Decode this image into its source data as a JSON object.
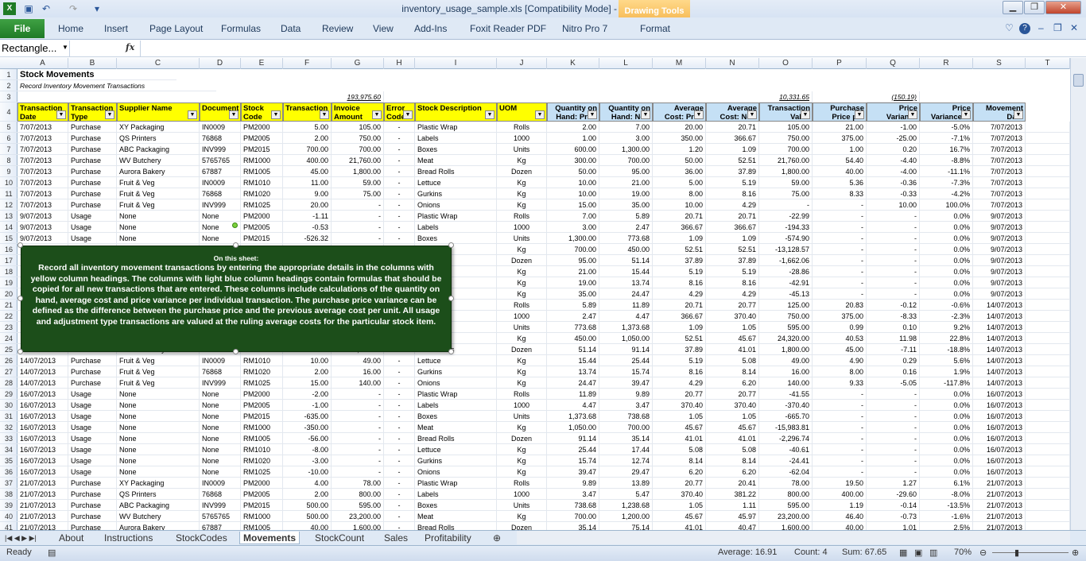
{
  "window": {
    "title": "inventory_usage_sample.xls  [Compatibility Mode]  -  Microsoft Excel",
    "context_tab": "Drawing Tools",
    "context_subtab": "Format"
  },
  "ribbon": {
    "file": "File",
    "tabs": [
      "Home",
      "Insert",
      "Page Layout",
      "Formulas",
      "Data",
      "Review",
      "View",
      "Add-Ins",
      "Foxit Reader PDF",
      "Nitro Pro 7"
    ]
  },
  "formula_bar": {
    "name_box": "Rectangle...",
    "fx": "fx",
    "formula": ""
  },
  "columns": [
    "A",
    "B",
    "C",
    "D",
    "E",
    "F",
    "G",
    "H",
    "I",
    "J",
    "K",
    "L",
    "M",
    "N",
    "O",
    "P",
    "Q",
    "R",
    "S",
    "T"
  ],
  "title": "Stock Movements",
  "subtitle": "Record Inventory Movement Transactions",
  "totals": {
    "G": "193,975.60",
    "O": "10,331.65",
    "Q": "(150.19)"
  },
  "headers": [
    "Transaction Date",
    "Transaction Type",
    "Supplier Name",
    "Document",
    "Stock Code",
    "Transaction",
    "Invoice Amount",
    "Error Code",
    "Stock Description",
    "UOM",
    "Quantity on Hand: Prior",
    "Quantity on Hand: New",
    "Average Cost: Prior",
    "Average Cost: New",
    "Transaction Value",
    "Purchase Price per",
    "Price Variance",
    "Price Variance %",
    "Movement Date"
  ],
  "rows": [
    [
      "7/07/2013",
      "Purchase",
      "XY Packaging",
      "IN0009",
      "PM2000",
      "5.00",
      "105.00",
      "-",
      "Plastic Wrap",
      "Rolls",
      "2.00",
      "7.00",
      "20.00",
      "20.71",
      "105.00",
      "21.00",
      "-1.00",
      "-5.0%",
      "7/07/2013"
    ],
    [
      "7/07/2013",
      "Purchase",
      "QS Printers",
      "76868",
      "PM2005",
      "2.00",
      "750.00",
      "-",
      "Labels",
      "1000",
      "1.00",
      "3.00",
      "350.00",
      "366.67",
      "750.00",
      "375.00",
      "-25.00",
      "-7.1%",
      "7/07/2013"
    ],
    [
      "7/07/2013",
      "Purchase",
      "ABC Packaging",
      "INV999",
      "PM2015",
      "700.00",
      "700.00",
      "-",
      "Boxes",
      "Units",
      "600.00",
      "1,300.00",
      "1.20",
      "1.09",
      "700.00",
      "1.00",
      "0.20",
      "16.7%",
      "7/07/2013"
    ],
    [
      "7/07/2013",
      "Purchase",
      "WV Butchery",
      "5765765",
      "RM1000",
      "400.00",
      "21,760.00",
      "-",
      "Meat",
      "Kg",
      "300.00",
      "700.00",
      "50.00",
      "52.51",
      "21,760.00",
      "54.40",
      "-4.40",
      "-8.8%",
      "7/07/2013"
    ],
    [
      "7/07/2013",
      "Purchase",
      "Aurora Bakery",
      "67887",
      "RM1005",
      "45.00",
      "1,800.00",
      "-",
      "Bread Rolls",
      "Dozen",
      "50.00",
      "95.00",
      "36.00",
      "37.89",
      "1,800.00",
      "40.00",
      "-4.00",
      "-11.1%",
      "7/07/2013"
    ],
    [
      "7/07/2013",
      "Purchase",
      "Fruit & Veg",
      "IN0009",
      "RM1010",
      "11.00",
      "59.00",
      "-",
      "Lettuce",
      "Kg",
      "10.00",
      "21.00",
      "5.00",
      "5.19",
      "59.00",
      "5.36",
      "-0.36",
      "-7.3%",
      "7/07/2013"
    ],
    [
      "7/07/2013",
      "Purchase",
      "Fruit & Veg",
      "76868",
      "RM1020",
      "9.00",
      "75.00",
      "-",
      "Gurkins",
      "Kg",
      "10.00",
      "19.00",
      "8.00",
      "8.16",
      "75.00",
      "8.33",
      "-0.33",
      "-4.2%",
      "7/07/2013"
    ],
    [
      "7/07/2013",
      "Purchase",
      "Fruit & Veg",
      "INV999",
      "RM1025",
      "20.00",
      "-",
      "-",
      "Onions",
      "Kg",
      "15.00",
      "35.00",
      "10.00",
      "4.29",
      "-",
      "-",
      "10.00",
      "100.0%",
      "7/07/2013"
    ],
    [
      "9/07/2013",
      "Usage",
      "None",
      "None",
      "PM2000",
      "-1.11",
      "-",
      "-",
      "Plastic Wrap",
      "Rolls",
      "7.00",
      "5.89",
      "20.71",
      "20.71",
      "-22.99",
      "-",
      "-",
      "0.0%",
      "9/07/2013"
    ],
    [
      "9/07/2013",
      "Usage",
      "None",
      "None",
      "PM2005",
      "-0.53",
      "-",
      "-",
      "Labels",
      "1000",
      "3.00",
      "2.47",
      "366.67",
      "366.67",
      "-194.33",
      "-",
      "-",
      "0.0%",
      "9/07/2013"
    ],
    [
      "9/07/2013",
      "Usage",
      "None",
      "None",
      "PM2015",
      "-526.32",
      "-",
      "-",
      "Boxes",
      "Units",
      "1,300.00",
      "773.68",
      "1.09",
      "1.09",
      "-574.90",
      "-",
      "-",
      "0.0%",
      "9/07/2013"
    ],
    [
      "",
      "",
      "",
      "",
      "",
      "",
      "",
      "",
      "",
      "Kg",
      "700.00",
      "450.00",
      "52.51",
      "52.51",
      "-13,128.57",
      "-",
      "-",
      "0.0%",
      "9/07/2013"
    ],
    [
      "",
      "",
      "",
      "",
      "",
      "",
      "",
      "",
      "ls",
      "Dozen",
      "95.00",
      "51.14",
      "37.89",
      "37.89",
      "-1,662.06",
      "-",
      "-",
      "0.0%",
      "9/07/2013"
    ],
    [
      "",
      "",
      "",
      "",
      "",
      "",
      "",
      "",
      "",
      "Kg",
      "21.00",
      "15.44",
      "5.19",
      "5.19",
      "-28.86",
      "-",
      "-",
      "0.0%",
      "9/07/2013"
    ],
    [
      "",
      "",
      "",
      "",
      "",
      "",
      "",
      "",
      "",
      "Kg",
      "19.00",
      "13.74",
      "8.16",
      "8.16",
      "-42.91",
      "-",
      "-",
      "0.0%",
      "9/07/2013"
    ],
    [
      "",
      "",
      "",
      "",
      "",
      "",
      "",
      "",
      "",
      "Kg",
      "35.00",
      "24.47",
      "4.29",
      "4.29",
      "-45.13",
      "-",
      "-",
      "0.0%",
      "9/07/2013"
    ],
    [
      "",
      "",
      "",
      "",
      "",
      "",
      "",
      "",
      "ap",
      "Rolls",
      "5.89",
      "11.89",
      "20.71",
      "20.77",
      "125.00",
      "20.83",
      "-0.12",
      "-0.6%",
      "14/07/2013"
    ],
    [
      "",
      "",
      "",
      "",
      "",
      "",
      "",
      "",
      "",
      "1000",
      "2.47",
      "4.47",
      "366.67",
      "370.40",
      "750.00",
      "375.00",
      "-8.33",
      "-2.3%",
      "14/07/2013"
    ],
    [
      "",
      "",
      "",
      "",
      "",
      "",
      "",
      "",
      "",
      "Units",
      "773.68",
      "1,373.68",
      "1.09",
      "1.05",
      "595.00",
      "0.99",
      "0.10",
      "9.2%",
      "14/07/2013"
    ],
    [
      "",
      "",
      "",
      "",
      "",
      "",
      "",
      "",
      "",
      "Kg",
      "450.00",
      "1,050.00",
      "52.51",
      "45.67",
      "24,320.00",
      "40.53",
      "11.98",
      "22.8%",
      "14/07/2013"
    ],
    [
      "14/07/2013",
      "Purchase",
      "Aurora Bakery",
      "67887",
      "RM1005",
      "40.00",
      "1,800.00",
      "-",
      "Bread Rolls",
      "Dozen",
      "51.14",
      "91.14",
      "37.89",
      "41.01",
      "1,800.00",
      "45.00",
      "-7.11",
      "-18.8%",
      "14/07/2013"
    ],
    [
      "14/07/2013",
      "Purchase",
      "Fruit & Veg",
      "IN0009",
      "RM1010",
      "10.00",
      "49.00",
      "-",
      "Lettuce",
      "Kg",
      "15.44",
      "25.44",
      "5.19",
      "5.08",
      "49.00",
      "4.90",
      "0.29",
      "5.6%",
      "14/07/2013"
    ],
    [
      "14/07/2013",
      "Purchase",
      "Fruit & Veg",
      "76868",
      "RM1020",
      "2.00",
      "16.00",
      "-",
      "Gurkins",
      "Kg",
      "13.74",
      "15.74",
      "8.16",
      "8.14",
      "16.00",
      "8.00",
      "0.16",
      "1.9%",
      "14/07/2013"
    ],
    [
      "14/07/2013",
      "Purchase",
      "Fruit & Veg",
      "INV999",
      "RM1025",
      "15.00",
      "140.00",
      "-",
      "Onions",
      "Kg",
      "24.47",
      "39.47",
      "4.29",
      "6.20",
      "140.00",
      "9.33",
      "-5.05",
      "-117.8%",
      "14/07/2013"
    ],
    [
      "16/07/2013",
      "Usage",
      "None",
      "None",
      "PM2000",
      "-2.00",
      "-",
      "-",
      "Plastic Wrap",
      "Rolls",
      "11.89",
      "9.89",
      "20.77",
      "20.77",
      "-41.55",
      "-",
      "-",
      "0.0%",
      "16/07/2013"
    ],
    [
      "16/07/2013",
      "Usage",
      "None",
      "None",
      "PM2005",
      "-1.00",
      "-",
      "-",
      "Labels",
      "1000",
      "4.47",
      "3.47",
      "370.40",
      "370.40",
      "-370.40",
      "-",
      "-",
      "0.0%",
      "16/07/2013"
    ],
    [
      "16/07/2013",
      "Usage",
      "None",
      "None",
      "PM2015",
      "-635.00",
      "-",
      "-",
      "Boxes",
      "Units",
      "1,373.68",
      "738.68",
      "1.05",
      "1.05",
      "-665.70",
      "-",
      "-",
      "0.0%",
      "16/07/2013"
    ],
    [
      "16/07/2013",
      "Usage",
      "None",
      "None",
      "RM1000",
      "-350.00",
      "-",
      "-",
      "Meat",
      "Kg",
      "1,050.00",
      "700.00",
      "45.67",
      "45.67",
      "-15,983.81",
      "-",
      "-",
      "0.0%",
      "16/07/2013"
    ],
    [
      "16/07/2013",
      "Usage",
      "None",
      "None",
      "RM1005",
      "-56.00",
      "-",
      "-",
      "Bread Rolls",
      "Dozen",
      "91.14",
      "35.14",
      "41.01",
      "41.01",
      "-2,296.74",
      "-",
      "-",
      "0.0%",
      "16/07/2013"
    ],
    [
      "16/07/2013",
      "Usage",
      "None",
      "None",
      "RM1010",
      "-8.00",
      "-",
      "-",
      "Lettuce",
      "Kg",
      "25.44",
      "17.44",
      "5.08",
      "5.08",
      "-40.61",
      "-",
      "-",
      "0.0%",
      "16/07/2013"
    ],
    [
      "16/07/2013",
      "Usage",
      "None",
      "None",
      "RM1020",
      "-3.00",
      "-",
      "-",
      "Gurkins",
      "Kg",
      "15.74",
      "12.74",
      "8.14",
      "8.14",
      "-24.41",
      "-",
      "-",
      "0.0%",
      "16/07/2013"
    ],
    [
      "16/07/2013",
      "Usage",
      "None",
      "None",
      "RM1025",
      "-10.00",
      "-",
      "-",
      "Onions",
      "Kg",
      "39.47",
      "29.47",
      "6.20",
      "6.20",
      "-62.04",
      "-",
      "-",
      "0.0%",
      "16/07/2013"
    ],
    [
      "21/07/2013",
      "Purchase",
      "XY Packaging",
      "IN0009",
      "PM2000",
      "4.00",
      "78.00",
      "-",
      "Plastic Wrap",
      "Rolls",
      "9.89",
      "13.89",
      "20.77",
      "20.41",
      "78.00",
      "19.50",
      "1.27",
      "6.1%",
      "21/07/2013"
    ],
    [
      "21/07/2013",
      "Purchase",
      "QS Printers",
      "76868",
      "PM2005",
      "2.00",
      "800.00",
      "-",
      "Labels",
      "1000",
      "3.47",
      "5.47",
      "370.40",
      "381.22",
      "800.00",
      "400.00",
      "-29.60",
      "-8.0%",
      "21/07/2013"
    ],
    [
      "21/07/2013",
      "Purchase",
      "ABC Packaging",
      "INV999",
      "PM2015",
      "500.00",
      "595.00",
      "-",
      "Boxes",
      "Units",
      "738.68",
      "1,238.68",
      "1.05",
      "1.11",
      "595.00",
      "1.19",
      "-0.14",
      "-13.5%",
      "21/07/2013"
    ],
    [
      "21/07/2013",
      "Purchase",
      "WV Butchery",
      "5765765",
      "RM1000",
      "500.00",
      "23,200.00",
      "-",
      "Meat",
      "Kg",
      "700.00",
      "1,200.00",
      "45.67",
      "45.97",
      "23,200.00",
      "46.40",
      "-0.73",
      "-1.6%",
      "21/07/2013"
    ],
    [
      "21/07/2013",
      "Purchase",
      "Aurora Bakery",
      "67887",
      "RM1005",
      "40.00",
      "1,600.00",
      "-",
      "Bread Rolls",
      "Dozen",
      "35.14",
      "75.14",
      "41.01",
      "40.47",
      "1,600.00",
      "40.00",
      "1.01",
      "2.5%",
      "21/07/2013"
    ]
  ],
  "note": {
    "heading": "On this sheet:",
    "body": "Record all inventory movement transactions by entering the appropriate details in the columns with  yellow column headings. The columns with light blue column headings contain formulas that should be copied for all new transactions that are entered. These columns include calculations of the quantity on hand, average cost and price variance per individual transaction. The purchase price variance can  be defined as the difference between the purchase price and the previous average cost per unit. All usage and adjustment type transactions are valued at the ruling average costs for the particular stock item."
  },
  "sheets": [
    "About",
    "Instructions",
    "StockCodes",
    "Movements",
    "StockCount",
    "Sales",
    "Profitability"
  ],
  "active_sheet": "Movements",
  "status": {
    "ready": "Ready",
    "average": "Average: 16.91",
    "count": "Count: 4",
    "sum": "Sum: 67.65",
    "zoom": "70%"
  }
}
